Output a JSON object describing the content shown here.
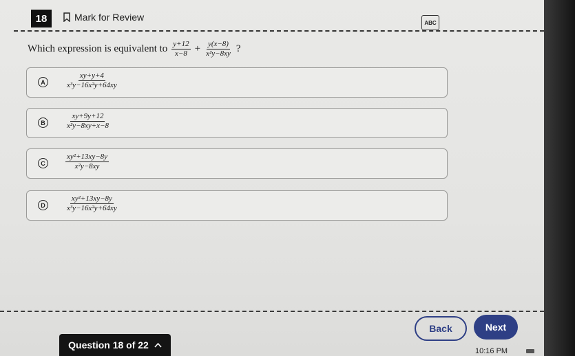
{
  "header": {
    "question_number": "18",
    "mark_for_review": "Mark for Review",
    "abc_tool": "ABC"
  },
  "question": {
    "prefix": "Which expression is equivalent to",
    "term1": {
      "num": "y+12",
      "den": "x−8"
    },
    "operator": "+",
    "term2": {
      "num": "y(x−8)",
      "den": "x²y−8xy"
    },
    "suffix": "?"
  },
  "options": [
    {
      "letter": "A",
      "num": "xy+y+4",
      "den": "x³y−16x²y+64xy"
    },
    {
      "letter": "B",
      "num": "xy+9y+12",
      "den": "x²y−8xy+x−8"
    },
    {
      "letter": "C",
      "num": "xy²+13xy−8y",
      "den": "x²y−8xy"
    },
    {
      "letter": "D",
      "num": "xy²+13xy−8y",
      "den": "x³y−16x²y+64xy"
    }
  ],
  "footer": {
    "question_counter": "Question 18 of 22",
    "back_label": "Back",
    "next_label": "Next",
    "clock": "10:16 PM"
  }
}
